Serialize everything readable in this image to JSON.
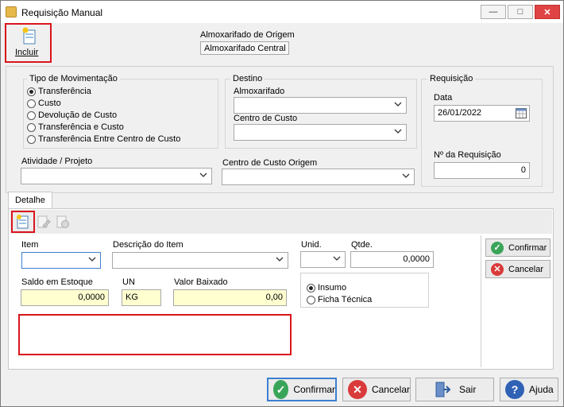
{
  "window": {
    "title": "Requisição Manual"
  },
  "toolbar": {
    "incluir_label": "Incluir"
  },
  "origem": {
    "label": "Almoxarifado de Origem",
    "value": "Almoxarifado Central"
  },
  "tipo": {
    "label": "Tipo de Movimentação",
    "options": [
      "Transferência",
      "Custo",
      "Devolução de Custo",
      "Transferência e Custo",
      "Transferência Entre Centro de Custo"
    ],
    "selected": "Transferência"
  },
  "destino": {
    "label": "Destino",
    "almox_label": "Almoxarifado",
    "centro_label": "Centro de Custo"
  },
  "requisicao": {
    "label": "Requisição",
    "data_label": "Data",
    "data_value": "26/01/2022",
    "numero_label": "Nº  da Requisição",
    "numero_value": "0"
  },
  "atividade": {
    "label": "Atividade / Projeto"
  },
  "centro_origem": {
    "label": "Centro de Custo Origem"
  },
  "tab": {
    "label": "Detalhe"
  },
  "detalhe": {
    "item_label": "Item",
    "descricao_label": "Descrição do Item",
    "unid_label": "Unid.",
    "qtde_label": "Qtde.",
    "qtde_value": "0,0000",
    "saldo_label": "Saldo em Estoque",
    "saldo_value": "0,0000",
    "un_label": "UN",
    "un_value": "KG",
    "valor_label": "Valor Baixado",
    "valor_value": "0,00",
    "tipo_options": [
      "Insumo",
      "Ficha Técnica"
    ],
    "tipo_selected": "Insumo",
    "confirmar_label": "Confirmar",
    "cancelar_label": "Cancelar"
  },
  "footer": {
    "confirmar_label": "Confirmar",
    "cancelar_label": "Cancelar",
    "sair_label": "Sair",
    "ajuda_label": "Ajuda"
  },
  "colors": {
    "highlight": "#d9141c",
    "ok_green": "#3aa55a",
    "cancel_red": "#d93a3a",
    "help_blue": "#2f62b5"
  }
}
